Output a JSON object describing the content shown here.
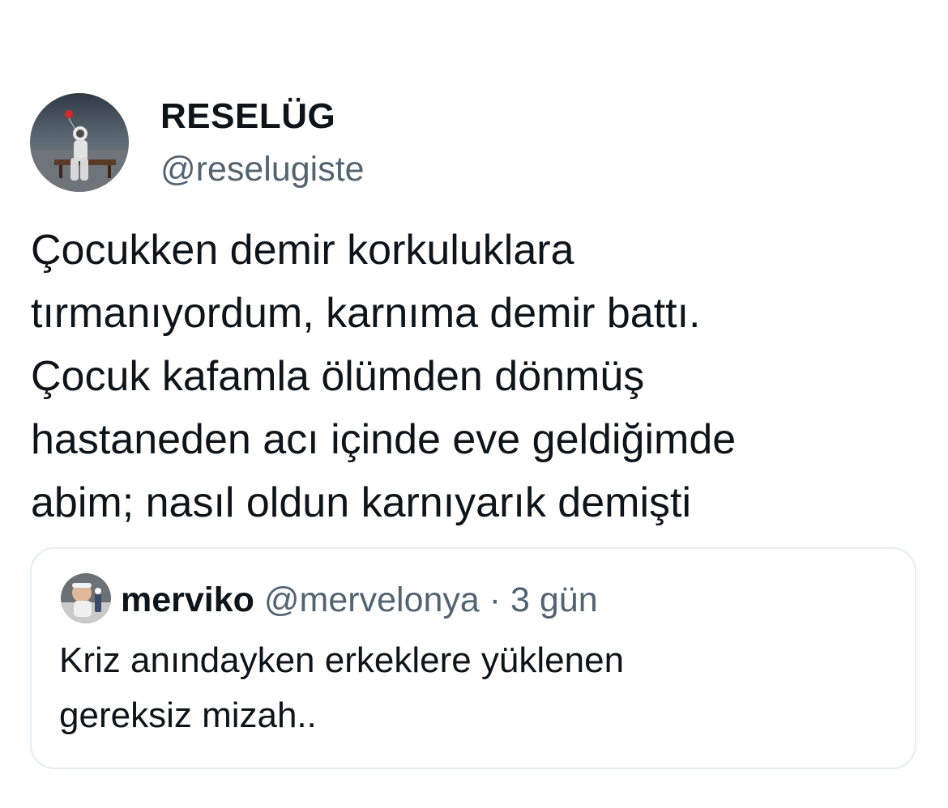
{
  "tweet": {
    "author": {
      "display_name": "RESELÜG",
      "handle": "@reselugiste",
      "avatar_icon": "astronaut-on-bench-avatar"
    },
    "text_lines": [
      "Çocukken demir korkuluklara",
      "tırmanıyordum, karnıma demir battı.",
      "Çocuk kafamla ölümden dönmüş",
      "hastaneden acı içinde eve geldiğimde",
      "abim; nasıl oldun karnıyarık demişti"
    ]
  },
  "quoted_tweet": {
    "author": {
      "display_name": "merviko",
      "handle": "@mervelonya",
      "avatar_icon": "child-photo-avatar"
    },
    "separator": " · ",
    "time": "3 gün",
    "text_lines": [
      "Kriz anındayken erkeklere yüklenen",
      "gereksiz mizah.."
    ]
  },
  "colors": {
    "text_primary": "#0f1419",
    "text_secondary": "#536471",
    "card_border": "#e6ecf0",
    "background": "#ffffff"
  }
}
